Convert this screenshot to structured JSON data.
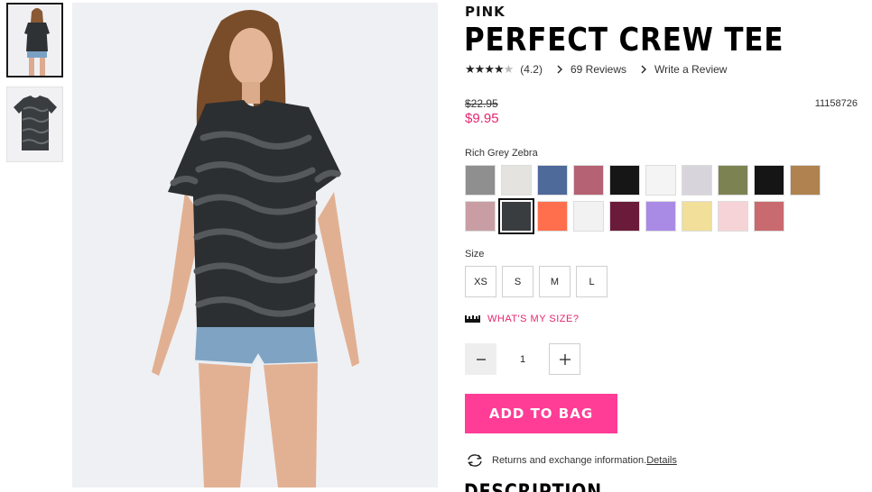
{
  "brand": "PINK",
  "product": {
    "title": "PERFECT CREW TEE",
    "rating": 4.2,
    "rating_text": "(4.2)",
    "reviews_link": "69 Reviews",
    "write_review_link": "Write a Review",
    "price_original": "$22.95",
    "price_sale": "$9.95",
    "sku": "11158726"
  },
  "colors": {
    "selected_label": "Rich Grey Zebra",
    "swatches": [
      {
        "name": "heather-grey",
        "color": "#8f8f8f"
      },
      {
        "name": "light-heather",
        "color": "#e4e3e0"
      },
      {
        "name": "blue",
        "color": "#4e6a9b"
      },
      {
        "name": "berry-tie-dye",
        "color": "#b56274"
      },
      {
        "name": "black-speckle",
        "color": "#161616"
      },
      {
        "name": "white-speckle",
        "color": "#f4f4f4"
      },
      {
        "name": "grey-tie-dye",
        "color": "#d8d4dc"
      },
      {
        "name": "camo",
        "color": "#7d8253"
      },
      {
        "name": "black",
        "color": "#151515"
      },
      {
        "name": "leopard",
        "color": "#b08250"
      },
      {
        "name": "stripe",
        "color": "#c89ea4"
      },
      {
        "name": "rich-grey-zebra",
        "color": "#3a3d40"
      },
      {
        "name": "coral",
        "color": "#ff6f4d"
      },
      {
        "name": "white",
        "color": "#f2f2f2"
      },
      {
        "name": "floral",
        "color": "#6b1b3a"
      },
      {
        "name": "lavender",
        "color": "#a98be6"
      },
      {
        "name": "yellow-tie-dye",
        "color": "#f1df9a"
      },
      {
        "name": "pale-pink",
        "color": "#f6d3d6"
      },
      {
        "name": "rose",
        "color": "#c86a6f"
      }
    ],
    "selected_index": 11
  },
  "size": {
    "label": "Size",
    "options": [
      "XS",
      "S",
      "M",
      "L"
    ],
    "guide_link": "WHAT'S MY SIZE?"
  },
  "quantity": {
    "value": "1"
  },
  "cta": {
    "add_to_bag": "ADD TO BAG"
  },
  "returns": {
    "text": "Returns and exchange information.",
    "details_link": "Details"
  },
  "description_heading": "DESCRIPTION",
  "icons": {
    "rating": "star-icon",
    "chevron": "chevron-right-icon",
    "ruler": "ruler-icon",
    "minus": "minus-icon",
    "plus": "plus-icon",
    "returns": "exchange-arrows-icon"
  }
}
